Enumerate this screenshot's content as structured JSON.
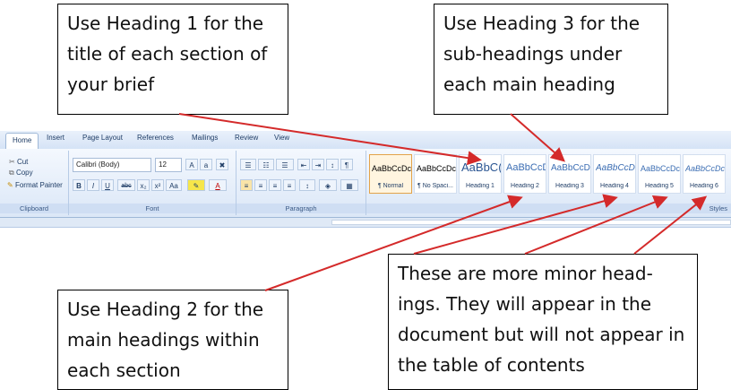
{
  "callouts": {
    "heading1": "Use Heading 1 for the title of each section of your brief",
    "heading3": "Use Heading 3 for the sub-headings under each main heading",
    "heading2": "Use Heading 2 for the main headings within each section",
    "minor": "These are more minor head-ings. They will appear in the document but will not appear in the table of contents"
  },
  "ribbon": {
    "tabs": [
      "Home",
      "Insert",
      "Page Layout",
      "References",
      "Mailings",
      "Review",
      "View"
    ],
    "active_tab": "Home",
    "clipboard": {
      "cut": "Cut",
      "copy": "Copy",
      "format_painter": "Format Painter",
      "label": "Clipboard"
    },
    "font": {
      "name": "Calibri (Body)",
      "size": "12",
      "label": "Font",
      "buttons": [
        "B",
        "I",
        "U",
        "abc",
        "x₂",
        "x²",
        "Aa"
      ]
    },
    "paragraph": {
      "label": "Paragraph"
    },
    "styles": {
      "label": "Styles",
      "tiles": [
        {
          "sample": "AaBbCcDc",
          "name": "¶ Normal"
        },
        {
          "sample": "AaBbCcDc",
          "name": "¶ No Spaci..."
        },
        {
          "sample": "AaBbC(",
          "name": "Heading 1"
        },
        {
          "sample": "AaBbCcD",
          "name": "Heading 2"
        },
        {
          "sample": "AaBbCcD",
          "name": "Heading 3"
        },
        {
          "sample": "AaBbCcD",
          "name": "Heading 4"
        },
        {
          "sample": "AaBbCcDc",
          "name": "Heading 5"
        },
        {
          "sample": "AaBbCcDc",
          "name": "Heading 6"
        }
      ]
    }
  },
  "colors": {
    "arrow": "#d42a2a",
    "ribbon_bg": "#dbe7f7",
    "selected_tile": "#fff5e0"
  }
}
